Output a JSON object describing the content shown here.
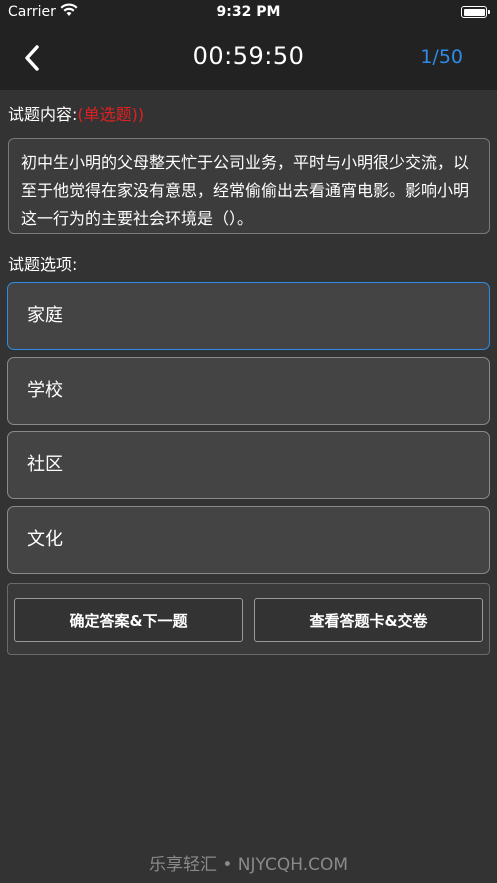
{
  "status_bar": {
    "carrier": "Carrier",
    "time": "9:32 PM",
    "wifi_icon": "wifi-icon",
    "battery_icon": "battery-icon"
  },
  "nav": {
    "back_icon": "chevron-left-icon",
    "timer": "00:59:50",
    "progress": "1/50",
    "progress_color": "#2e8be6"
  },
  "question": {
    "label": "试题内容:",
    "type": "(单选题))",
    "type_color": "#e02020",
    "text": "初中生小明的父母整天忙于公司业务，平时与小明很少交流，以至于他觉得在家没有意思，经常偷偷出去看通宵电影。影响小明这一行为的主要社会环境是（）。"
  },
  "options_label": "试题选项:",
  "options": [
    {
      "label": "家庭",
      "selected": true
    },
    {
      "label": "学校",
      "selected": false
    },
    {
      "label": "社区",
      "selected": false
    },
    {
      "label": "文化",
      "selected": false
    }
  ],
  "actions": {
    "confirm_next": "确定答案&下一题",
    "view_card_submit": "查看答题卡&交卷"
  },
  "watermark": "乐享轻汇 • NJYCQH.COM"
}
